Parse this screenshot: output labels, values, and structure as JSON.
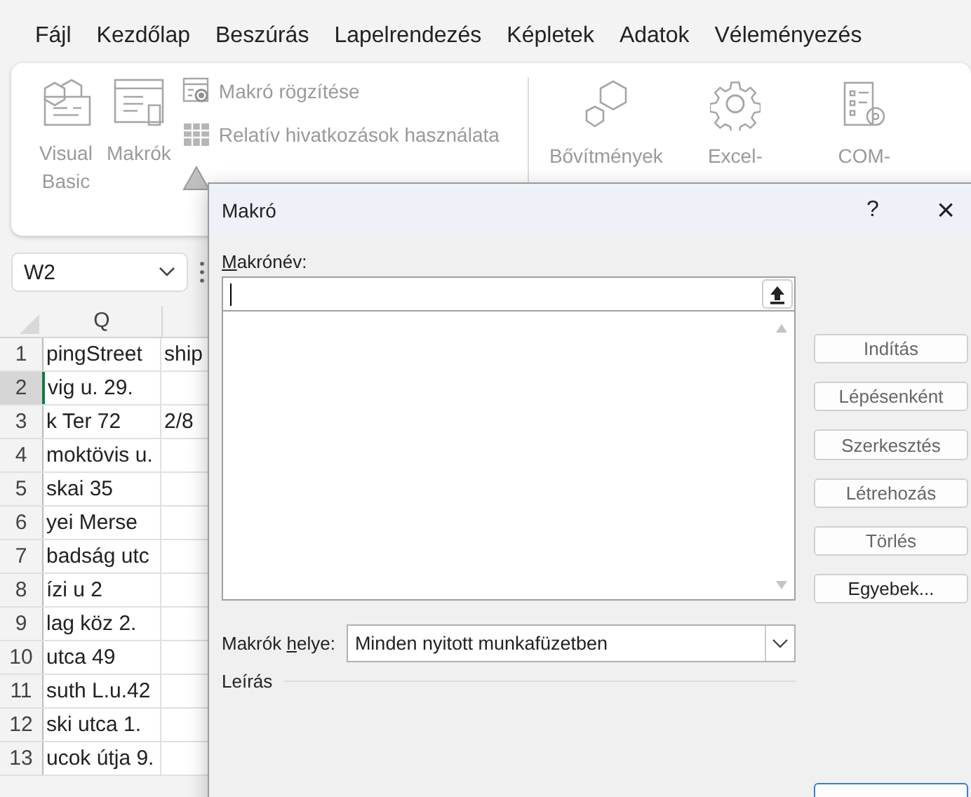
{
  "menu": [
    {
      "label": "Fájl"
    },
    {
      "label": "Kezdőlap"
    },
    {
      "label": "Beszúrás"
    },
    {
      "label": "Lapelrendezés"
    },
    {
      "label": "Képletek"
    },
    {
      "label": "Adatok"
    },
    {
      "label": "Véleményezés"
    }
  ],
  "ribbon": {
    "large_buttons": [
      {
        "kind": "vba",
        "lines": [
          "Visual",
          "Basic"
        ],
        "disabled": true
      },
      {
        "kind": "macros",
        "lines": [
          "Makrók"
        ],
        "disabled": true
      }
    ],
    "small_buttons": [
      {
        "kind": "record",
        "label": "Makró rögzítése",
        "disabled": true
      },
      {
        "kind": "relative",
        "label": "Relatív hivatkozások használata",
        "disabled": true
      },
      {
        "kind": "security"
      }
    ],
    "addin_buttons": [
      {
        "kind": "addins",
        "lines": [
          "Bővítmények"
        ],
        "disabled": true
      },
      {
        "kind": "excel-addins",
        "lines": [
          "Excel-"
        ],
        "disabled": true
      },
      {
        "kind": "com-addins",
        "lines": [
          "COM-"
        ],
        "disabled": true
      }
    ]
  },
  "name_box": {
    "value": "W2"
  },
  "sheet": {
    "columns": [
      "Q"
    ],
    "rows": [
      {
        "num": "1",
        "col_q": "pingStreet",
        "col_r": "ship",
        "selected": false
      },
      {
        "num": "2",
        "col_q": "vig u. 29.",
        "col_r": "",
        "selected": true
      },
      {
        "num": "3",
        "col_q": "k Ter 72",
        "col_r": "2/8",
        "selected": false
      },
      {
        "num": "4",
        "col_q": "moktövis u.",
        "col_r": "",
        "selected": false
      },
      {
        "num": "5",
        "col_q": "skai 35",
        "col_r": "",
        "selected": false
      },
      {
        "num": "6",
        "col_q": "yei Merse",
        "col_r": "",
        "selected": false
      },
      {
        "num": "7",
        "col_q": "badság utc",
        "col_r": "",
        "selected": false
      },
      {
        "num": "8",
        "col_q": "ízi u 2",
        "col_r": "",
        "selected": false
      },
      {
        "num": "9",
        "col_q": "lag köz 2.",
        "col_r": "",
        "selected": false
      },
      {
        "num": "10",
        "col_q": "utca 49",
        "col_r": "",
        "selected": false
      },
      {
        "num": "11",
        "col_q": "suth L.u.42",
        "col_r": "",
        "selected": false
      },
      {
        "num": "12",
        "col_q": "ski utca 1.",
        "col_r": "",
        "selected": false
      },
      {
        "num": "13",
        "col_q": "ucok útja 9.",
        "col_r": "",
        "selected": false
      }
    ]
  },
  "dialog": {
    "title": "Makró",
    "help": "?",
    "close": "×",
    "name_label": "Makrónév:",
    "location_label": "Makrók helye:",
    "location_value": "Minden nyitott munkafüzetben",
    "description_label": "Leírás",
    "buttons": [
      {
        "label": "Indítás",
        "disabled": true
      },
      {
        "label": "Lépésenként",
        "disabled": true
      },
      {
        "label": "Szerkesztés",
        "disabled": true
      },
      {
        "label": "Létrehozás",
        "disabled": true
      },
      {
        "label": "Törlés",
        "disabled": true
      },
      {
        "label": "Egyebek...",
        "disabled": false
      }
    ]
  }
}
